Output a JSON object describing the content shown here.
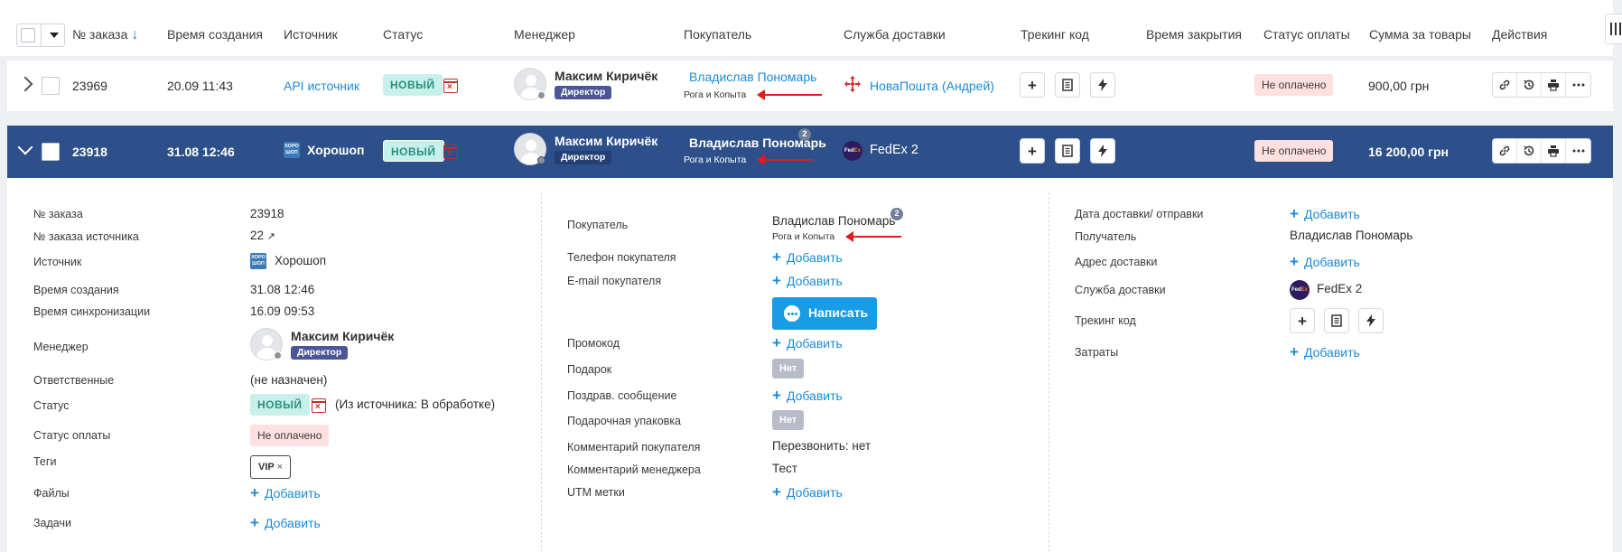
{
  "header": {
    "columns": [
      "№ заказа",
      "Время создания",
      "Источник",
      "Статус",
      "Менеджер",
      "Покупатель",
      "Служба доставки",
      "Трекинг код",
      "Время закрытия",
      "Статус оплаты",
      "Сумма за товары",
      "Действия"
    ],
    "sort_icon": "arrow-down-icon"
  },
  "orders": [
    {
      "id": "23969",
      "created": "20.09 11:43",
      "source": "API источник",
      "status": "НОВЫЙ",
      "manager_name": "Максим Киричёк",
      "manager_role": "Директор",
      "buyer_name": "Владислав Пономарь",
      "buyer_company": "Рога и Копыта",
      "delivery": "НоваПошта (Андрей)",
      "payment_status": "Не оплачено",
      "sum": "900,00 грн"
    },
    {
      "id": "23918",
      "created": "31.08 12:46",
      "source": "Хорошоп",
      "status": "НОВЫЙ",
      "manager_name": "Максим Киричёк",
      "manager_role": "Директор",
      "buyer_name": "Владислав Пономарь",
      "buyer_count": "2",
      "buyer_company": "Рога и Копыта",
      "delivery": "FedEx 2",
      "payment_status": "Не оплачено",
      "sum": "16 200,00 грн"
    }
  ],
  "source_logo_text": [
    "ХОРО",
    "ШОП"
  ],
  "fedex_logo_text": [
    "Fed",
    "Ex"
  ],
  "detail": {
    "left": {
      "order_no_label": "№ заказа",
      "order_no": "23918",
      "source_order_label": "№ заказа источника",
      "source_order": "22",
      "source_label": "Источник",
      "source": "Хорошоп",
      "created_label": "Время создания",
      "created": "31.08 12:46",
      "synced_label": "Время синхронизации",
      "synced": "16.09 09:53",
      "manager_label": "Менеджер",
      "manager_name": "Максим Киричёк",
      "manager_role": "Директор",
      "responsible_label": "Ответственные",
      "responsible": "(не назначен)",
      "status_label": "Статус",
      "status": "НОВЫЙ",
      "status_source": "(Из источника: В обработке)",
      "payment_label": "Статус оплаты",
      "payment": "Не оплачено",
      "tags_label": "Теги",
      "tag": "VIP",
      "files_label": "Файлы",
      "tasks_label": "Задачи",
      "add_label": "Добавить"
    },
    "middle": {
      "buyer_label": "Покупатель",
      "buyer_name": "Владислав Пономарь",
      "buyer_count": "2",
      "buyer_company": "Рога и Копыта",
      "phone_label": "Телефон покупателя",
      "email_label": "E-mail покупателя",
      "write_button": "Написать",
      "promo_label": "Промокод",
      "gift_label": "Подарок",
      "gift_value": "Нет",
      "greeting_label": "Поздрав. сообщение",
      "wrap_label": "Подарочная упаковка",
      "wrap_value": "Нет",
      "buyer_comment_label": "Комментарий покупателя",
      "buyer_comment": "Перезвонить: нет",
      "manager_comment_label": "Комментарий менеджера",
      "manager_comment": "Тест",
      "utm_label": "UTM метки",
      "add_label": "Добавить"
    },
    "right": {
      "delivery_date_label": "Дата доставки/ отправки",
      "recipient_label": "Получатель",
      "recipient": "Владислав Пономарь",
      "address_label": "Адрес доставки",
      "service_label": "Служба доставки",
      "service": "FedEx 2",
      "tracking_label": "Трекинг код",
      "costs_label": "Затраты",
      "add_label": "Добавить"
    }
  },
  "colors": {
    "accent": "#1c8ad8",
    "selected_row": "#2d4f8a",
    "status_new_bg": "#c8f0ea",
    "unpaid_bg": "#fde0df",
    "annotation_arrow": "#e01b1b"
  }
}
